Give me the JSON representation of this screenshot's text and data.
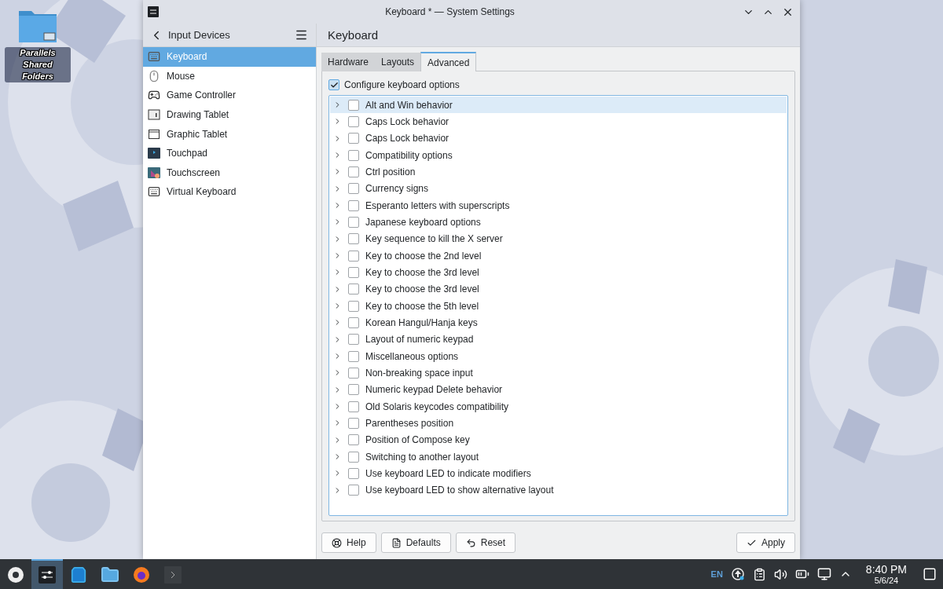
{
  "desktop_icons": [
    {
      "label": "Parallels Shared Folders"
    }
  ],
  "window": {
    "title": "Keyboard * — System Settings",
    "sidebar": {
      "title": "Input Devices",
      "items": [
        {
          "kind": "keyboard",
          "label": "Keyboard",
          "selected": true
        },
        {
          "kind": "mouse",
          "label": "Mouse",
          "selected": false
        },
        {
          "kind": "gamepad",
          "label": "Game Controller",
          "selected": false
        },
        {
          "kind": "drawing-tablet",
          "label": "Drawing Tablet",
          "selected": false
        },
        {
          "kind": "graphic-tablet",
          "label": "Graphic Tablet",
          "selected": false
        },
        {
          "kind": "touchpad",
          "label": "Touchpad",
          "selected": false
        },
        {
          "kind": "touchscreen",
          "label": "Touchscreen",
          "selected": false
        },
        {
          "kind": "virtual-keyboard",
          "label": "Virtual Keyboard",
          "selected": false
        }
      ]
    },
    "page_title": "Keyboard",
    "tabs": [
      {
        "label": "Hardware",
        "selected": false
      },
      {
        "label": "Layouts",
        "selected": false
      },
      {
        "label": "Advanced",
        "selected": true
      }
    ],
    "configure_option": {
      "label": "Configure keyboard options",
      "checked": true
    },
    "options": [
      {
        "label": "Alt and Win behavior",
        "checked": false,
        "selected": true
      },
      {
        "label": "Caps Lock behavior",
        "checked": false,
        "selected": false
      },
      {
        "label": "Caps Lock behavior",
        "checked": false,
        "selected": false
      },
      {
        "label": "Compatibility options",
        "checked": false,
        "selected": false
      },
      {
        "label": "Ctrl position",
        "checked": false,
        "selected": false
      },
      {
        "label": "Currency signs",
        "checked": false,
        "selected": false
      },
      {
        "label": "Esperanto letters with superscripts",
        "checked": false,
        "selected": false
      },
      {
        "label": "Japanese keyboard options",
        "checked": false,
        "selected": false
      },
      {
        "label": "Key sequence to kill the X server",
        "checked": false,
        "selected": false
      },
      {
        "label": "Key to choose the 2nd level",
        "checked": false,
        "selected": false
      },
      {
        "label": "Key to choose the 3rd level",
        "checked": false,
        "selected": false
      },
      {
        "label": "Key to choose the 3rd level",
        "checked": false,
        "selected": false
      },
      {
        "label": "Key to choose the 5th level",
        "checked": false,
        "selected": false
      },
      {
        "label": "Korean Hangul/Hanja keys",
        "checked": false,
        "selected": false
      },
      {
        "label": "Layout of numeric keypad",
        "checked": false,
        "selected": false
      },
      {
        "label": "Miscellaneous options",
        "checked": false,
        "selected": false
      },
      {
        "label": "Non-breaking space input",
        "checked": false,
        "selected": false
      },
      {
        "label": "Numeric keypad Delete behavior",
        "checked": false,
        "selected": false
      },
      {
        "label": "Old Solaris keycodes compatibility",
        "checked": false,
        "selected": false
      },
      {
        "label": "Parentheses position",
        "checked": false,
        "selected": false
      },
      {
        "label": "Position of Compose key",
        "checked": false,
        "selected": false
      },
      {
        "label": "Switching to another layout",
        "checked": false,
        "selected": false
      },
      {
        "label": "Use keyboard LED to indicate modifiers",
        "checked": false,
        "selected": false
      },
      {
        "label": "Use keyboard LED to show alternative layout",
        "checked": false,
        "selected": false
      }
    ],
    "buttons": [
      {
        "kind": "help",
        "label": "Help"
      },
      {
        "kind": "defaults",
        "label": "Defaults"
      },
      {
        "kind": "reset",
        "label": "Reset"
      },
      {
        "kind": "apply",
        "label": "Apply"
      }
    ]
  },
  "taskbar": {
    "tasks": [
      {
        "kind": "launcher",
        "selected": false
      },
      {
        "kind": "settings",
        "selected": true
      },
      {
        "kind": "store",
        "selected": false
      },
      {
        "kind": "files",
        "selected": false
      },
      {
        "kind": "browser",
        "selected": false
      },
      {
        "kind": "terminal",
        "selected": false
      }
    ],
    "language": "EN",
    "time": "8:40 PM",
    "date": "5/6/24"
  }
}
